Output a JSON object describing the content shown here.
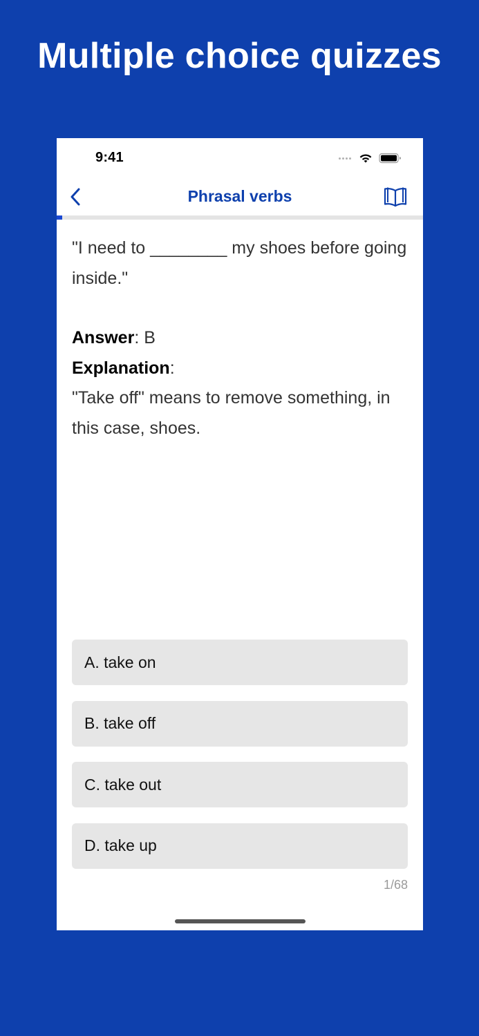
{
  "headline": "Multiple choice quizzes",
  "status_bar": {
    "time": "9:41"
  },
  "nav": {
    "title": "Phrasal verbs",
    "back_icon": "chevron-left-icon",
    "book_icon": "book-icon"
  },
  "progress": {
    "current": 1,
    "total": 68
  },
  "question": {
    "text": "\"I need to ________ my shoes before going inside.\"",
    "answer_label": "Answer",
    "answer_value": ": B",
    "explanation_label": "Explanation",
    "explanation_colon": ":",
    "explanation_text": "\"Take off\" means to remove something, in this case, shoes."
  },
  "options": [
    {
      "label": "A. take on"
    },
    {
      "label": "B. take off"
    },
    {
      "label": "C. take out"
    },
    {
      "label": "D. take up"
    }
  ],
  "counter": "1/68",
  "colors": {
    "background": "#0e40ad",
    "accent": "#0e40ad",
    "progress": "#1a48d2",
    "option_bg": "#e6e6e6"
  }
}
